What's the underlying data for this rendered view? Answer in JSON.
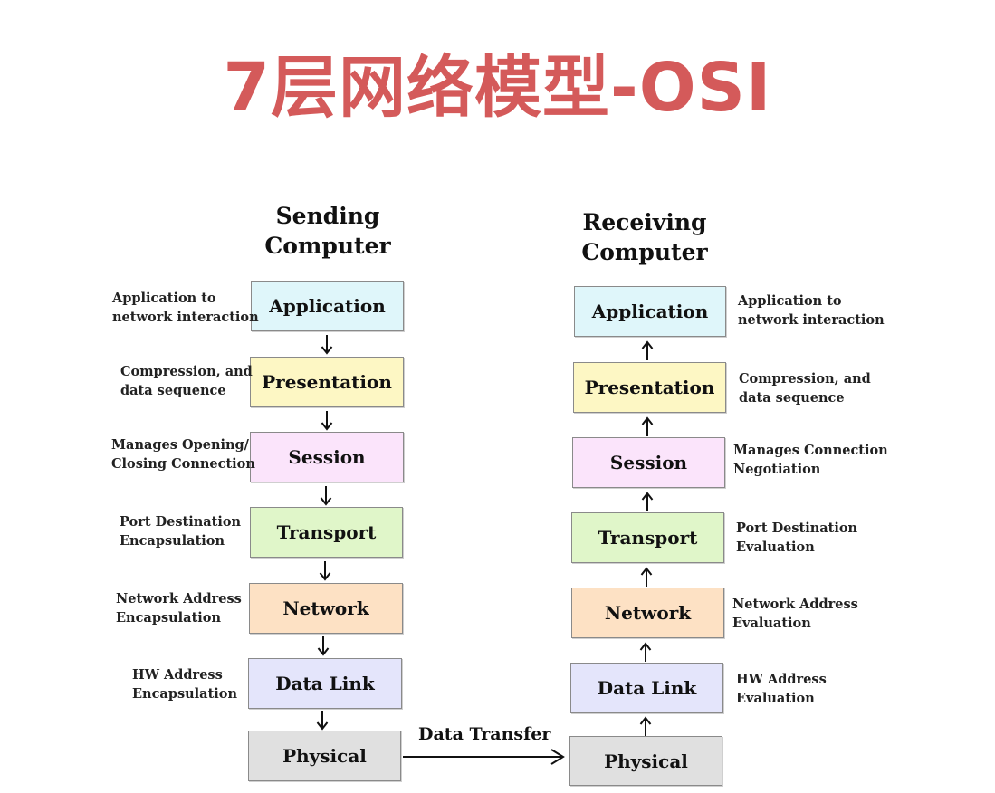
{
  "title": "7层网络模型-OSI",
  "sending": {
    "heading_line1": "Sending",
    "heading_line2": "Computer",
    "layers": [
      {
        "name": "Application",
        "color": "#dff6fa",
        "desc_line1": "Application to",
        "desc_line2": "network interaction"
      },
      {
        "name": "Presentation",
        "color": "#fdf7c4",
        "desc_line1": "Compression, and",
        "desc_line2": "data sequence"
      },
      {
        "name": "Session",
        "color": "#fbe4fb",
        "desc_line1": "Manages Opening/",
        "desc_line2": "Closing Connection"
      },
      {
        "name": "Transport",
        "color": "#e0f6c9",
        "desc_line1": "Port Destination",
        "desc_line2": "Encapsulation"
      },
      {
        "name": "Network",
        "color": "#fde1c4",
        "desc_line1": "Network Address",
        "desc_line2": "Encapsulation"
      },
      {
        "name": "Data Link",
        "color": "#e4e5fb",
        "desc_line1": "HW Address",
        "desc_line2": "Encapsulation"
      },
      {
        "name": "Physical",
        "color": "#e0e0e0"
      }
    ]
  },
  "receiving": {
    "heading_line1": "Receiving",
    "heading_line2": "Computer",
    "layers": [
      {
        "name": "Application",
        "color": "#dff6fa",
        "desc_line1": "Application to",
        "desc_line2": "network interaction"
      },
      {
        "name": "Presentation",
        "color": "#fdf7c4",
        "desc_line1": "Compression, and",
        "desc_line2": "data sequence"
      },
      {
        "name": "Session",
        "color": "#fbe4fb",
        "desc_line1": "Manages Connection",
        "desc_line2": "Negotiation"
      },
      {
        "name": "Transport",
        "color": "#e0f6c9",
        "desc_line1": "Port Destination",
        "desc_line2": "Evaluation"
      },
      {
        "name": "Network",
        "color": "#fde1c4",
        "desc_line1": "Network Address",
        "desc_line2": "Evaluation"
      },
      {
        "name": "Data Link",
        "color": "#e4e5fb",
        "desc_line1": "HW Address",
        "desc_line2": "Evaluation"
      },
      {
        "name": "Physical",
        "color": "#e0e0e0"
      }
    ]
  },
  "transfer_label": "Data Transfer"
}
